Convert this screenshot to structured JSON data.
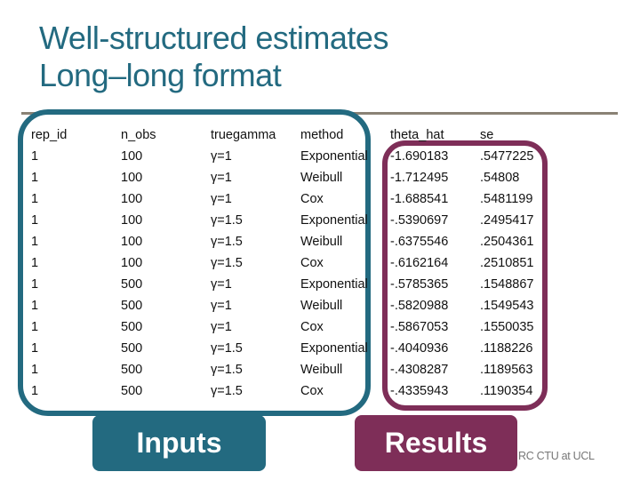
{
  "slide": {
    "title_line1": "Well-structured estimates",
    "title_line2": "Long–long format",
    "footer": "RC CTU at UCL"
  },
  "colors": {
    "inputs": "#236a80",
    "results": "#7e2e58",
    "rule": "#8a8275"
  },
  "table": {
    "headers": [
      "rep_id",
      "n_obs",
      "truegamma",
      "method",
      "theta_hat",
      "se"
    ],
    "rows": [
      [
        "1",
        "100",
        "γ=1",
        "Exponential",
        "-1.690183",
        ".5477225"
      ],
      [
        "1",
        "100",
        "γ=1",
        "Weibull",
        "-1.712495",
        ".54808"
      ],
      [
        "1",
        "100",
        "γ=1",
        "Cox",
        "-1.688541",
        ".5481199"
      ],
      [
        "1",
        "100",
        "γ=1.5",
        "Exponential",
        "-.5390697",
        ".2495417"
      ],
      [
        "1",
        "100",
        "γ=1.5",
        "Weibull",
        "-.6375546",
        ".2504361"
      ],
      [
        "1",
        "100",
        "γ=1.5",
        "Cox",
        "-.6162164",
        ".2510851"
      ],
      [
        "1",
        "500",
        "γ=1",
        "Exponential",
        "-.5785365",
        ".1548867"
      ],
      [
        "1",
        "500",
        "γ=1",
        "Weibull",
        "-.5820988",
        ".1549543"
      ],
      [
        "1",
        "500",
        "γ=1",
        "Cox",
        "-.5867053",
        ".1550035"
      ],
      [
        "1",
        "500",
        "γ=1.5",
        "Exponential",
        "-.4040936",
        ".1188226"
      ],
      [
        "1",
        "500",
        "γ=1.5",
        "Weibull",
        "-.4308287",
        ".1189563"
      ],
      [
        "1",
        "500",
        "γ=1.5",
        "Cox",
        "-.4335943",
        ".1190354"
      ]
    ]
  },
  "labels": {
    "inputs": "Inputs",
    "results": "Results"
  }
}
